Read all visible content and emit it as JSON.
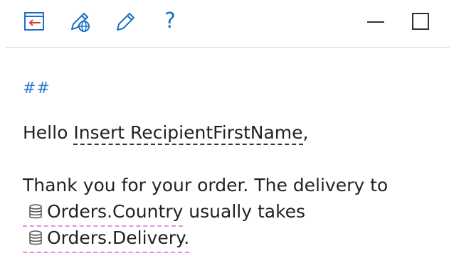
{
  "toolbar": {
    "buttons": [
      {
        "name": "exit-document-button",
        "icon": "exit-document-icon"
      },
      {
        "name": "edit-with-web-button",
        "icon": "pen-globe-icon"
      },
      {
        "name": "edit-button",
        "icon": "pencil-icon"
      },
      {
        "name": "help-button",
        "icon": "question-mark-icon",
        "glyph": "?"
      }
    ],
    "window_controls": [
      {
        "name": "minimize-button",
        "icon": "minimize-icon"
      },
      {
        "name": "maximize-button",
        "icon": "maximize-icon"
      }
    ]
  },
  "colors": {
    "icon_blue": "#1f6fc4",
    "accent_red": "#d83b3b",
    "heading_blue": "#2b7bcb",
    "db_field_underline": "#e58fe0",
    "merge_field_underline": "#333333",
    "divider": "#dcdcdc"
  },
  "document": {
    "heading_marker": "##",
    "greeting": {
      "prefix": "Hello ",
      "merge_field": "Insert RecipientFirstName",
      "suffix": ","
    },
    "body_line": "Thank you for your order. The delivery to",
    "field_country": {
      "icon": "database-icon",
      "label": "Orders.Country",
      "suffix": " usually takes"
    },
    "field_delivery": {
      "icon": "database-icon",
      "label": "Orders.Delivery",
      "suffix": "."
    }
  }
}
